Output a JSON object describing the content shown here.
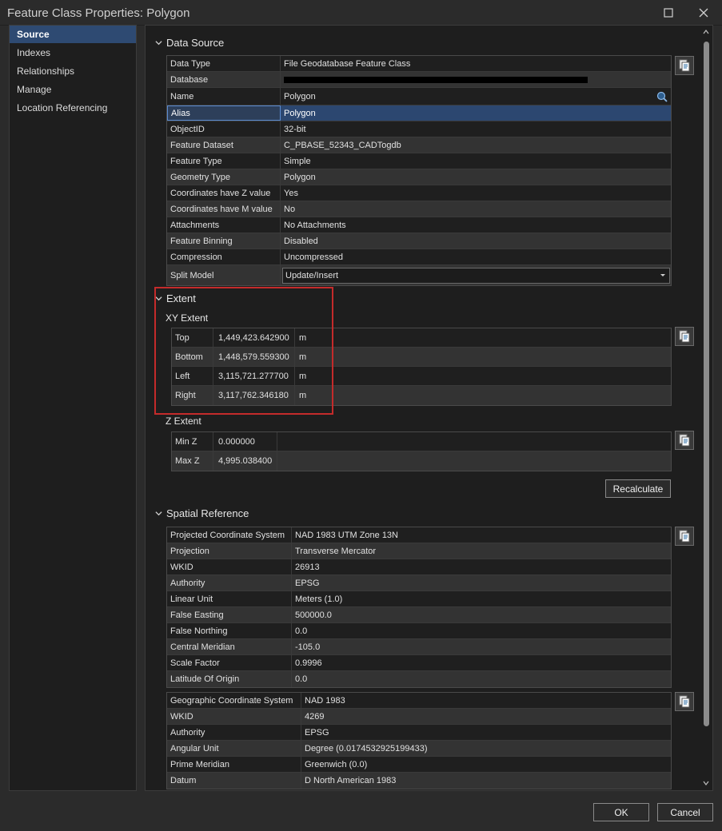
{
  "window": {
    "title": "Feature Class Properties: Polygon"
  },
  "sidebar": {
    "items": [
      {
        "label": "Source",
        "active": true
      },
      {
        "label": "Indexes"
      },
      {
        "label": "Relationships"
      },
      {
        "label": "Manage"
      },
      {
        "label": "Location Referencing"
      }
    ]
  },
  "data_source": {
    "header": "Data Source",
    "rows": [
      {
        "label": "Data Type",
        "value": "File Geodatabase Feature Class"
      },
      {
        "label": "Database",
        "value": ""
      },
      {
        "label": "Name",
        "value": "Polygon"
      },
      {
        "label": "Alias",
        "value": "Polygon"
      },
      {
        "label": "ObjectID",
        "value": "32-bit"
      },
      {
        "label": "Feature Dataset",
        "value": "C_PBASE_52343_CADTogdb"
      },
      {
        "label": "Feature Type",
        "value": "Simple"
      },
      {
        "label": "Geometry Type",
        "value": "Polygon"
      },
      {
        "label": "Coordinates have Z value",
        "value": "Yes"
      },
      {
        "label": "Coordinates have M value",
        "value": "No"
      },
      {
        "label": "Attachments",
        "value": "No Attachments"
      },
      {
        "label": "Feature Binning",
        "value": "Disabled"
      },
      {
        "label": "Compression",
        "value": "Uncompressed"
      },
      {
        "label": "Split Model",
        "value": "Update/Insert"
      }
    ]
  },
  "extent": {
    "header": "Extent",
    "xy_header": "XY Extent",
    "xy_rows": [
      {
        "label": "Top",
        "value": "1,449,423.642900",
        "unit": "m"
      },
      {
        "label": "Bottom",
        "value": "1,448,579.559300",
        "unit": "m"
      },
      {
        "label": "Left",
        "value": "3,115,721.277700",
        "unit": "m"
      },
      {
        "label": "Right",
        "value": "3,117,762.346180",
        "unit": "m"
      }
    ],
    "z_header": "Z Extent",
    "z_rows": [
      {
        "label": "Min Z",
        "value": "0.000000"
      },
      {
        "label": "Max Z",
        "value": "4,995.038400"
      }
    ],
    "recalculate_label": "Recalculate"
  },
  "spatial_reference": {
    "header": "Spatial Reference",
    "projected_rows": [
      {
        "label": "Projected Coordinate System",
        "value": "NAD 1983 UTM Zone 13N"
      },
      {
        "label": "Projection",
        "value": "Transverse Mercator"
      },
      {
        "label": "WKID",
        "value": "26913"
      },
      {
        "label": "Authority",
        "value": "EPSG"
      },
      {
        "label": "Linear Unit",
        "value": "Meters (1.0)"
      },
      {
        "label": "False Easting",
        "value": "500000.0"
      },
      {
        "label": "False Northing",
        "value": "0.0"
      },
      {
        "label": "Central Meridian",
        "value": "-105.0"
      },
      {
        "label": "Scale Factor",
        "value": "0.9996"
      },
      {
        "label": "Latitude Of Origin",
        "value": "0.0"
      }
    ],
    "geographic_rows": [
      {
        "label": "Geographic Coordinate System",
        "value": "NAD 1983"
      },
      {
        "label": "WKID",
        "value": "4269"
      },
      {
        "label": "Authority",
        "value": "EPSG"
      },
      {
        "label": "Angular Unit",
        "value": "Degree (0.0174532925199433)"
      },
      {
        "label": "Prime Meridian",
        "value": "Greenwich (0.0)"
      },
      {
        "label": "Datum",
        "value": "D North American 1983"
      }
    ]
  },
  "footer": {
    "ok_label": "OK",
    "cancel_label": "Cancel"
  },
  "colors": {
    "accent": "#2c4770",
    "highlight": "#c42b2b"
  }
}
